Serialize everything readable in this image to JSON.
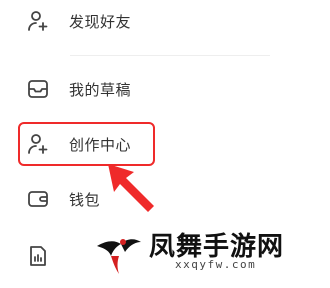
{
  "menu": {
    "items": [
      {
        "label": "发现好友",
        "icon": "add-user-icon"
      },
      {
        "label": "我的草稿",
        "icon": "drafts-icon"
      },
      {
        "label": "创作中心",
        "icon": "add-user-icon"
      },
      {
        "label": "钱包",
        "icon": "wallet-icon"
      },
      {
        "label": "",
        "icon": "chart-bars-icon"
      }
    ]
  },
  "annotation": {
    "color": "#ef2a2a"
  },
  "watermark": {
    "title": "凤舞手游网",
    "url": "xxqyfw.com"
  }
}
